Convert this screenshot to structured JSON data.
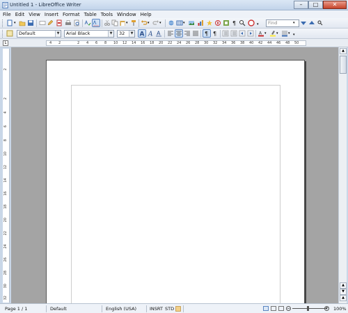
{
  "window": {
    "title": "Untitled 1 - LibreOffice Writer",
    "minimize": "–",
    "maximize": "□",
    "close": "✕"
  },
  "menu": [
    "File",
    "Edit",
    "View",
    "Insert",
    "Format",
    "Table",
    "Tools",
    "Window",
    "Help"
  ],
  "standard_toolbar": {
    "find_placeholder": "Find"
  },
  "formatting_toolbar": {
    "paragraph_style": "Default",
    "font_name": "Arial Black",
    "font_size": "32"
  },
  "ruler": {
    "horizontal_ticks": [
      "4",
      "2",
      "2",
      "4",
      "6",
      "8",
      "10",
      "12",
      "14",
      "16",
      "18",
      "20",
      "22",
      "24",
      "26",
      "28",
      "30",
      "32",
      "34",
      "36",
      "38",
      "40",
      "42",
      "44",
      "46",
      "48",
      "50"
    ],
    "vertical_ticks": [
      "2",
      "2",
      "4",
      "6",
      "8",
      "10",
      "12",
      "14",
      "16",
      "18",
      "20",
      "22",
      "24",
      "26",
      "28",
      "30",
      "32"
    ]
  },
  "status": {
    "page": "Page 1 / 1",
    "page_style": "Default",
    "language": "English (USA)",
    "insert_mode": "INSRT",
    "selection_mode": "STD",
    "zoom": "100%"
  },
  "colors": {
    "accent": "#5b86c2",
    "workspace": "#a4a4a4"
  }
}
